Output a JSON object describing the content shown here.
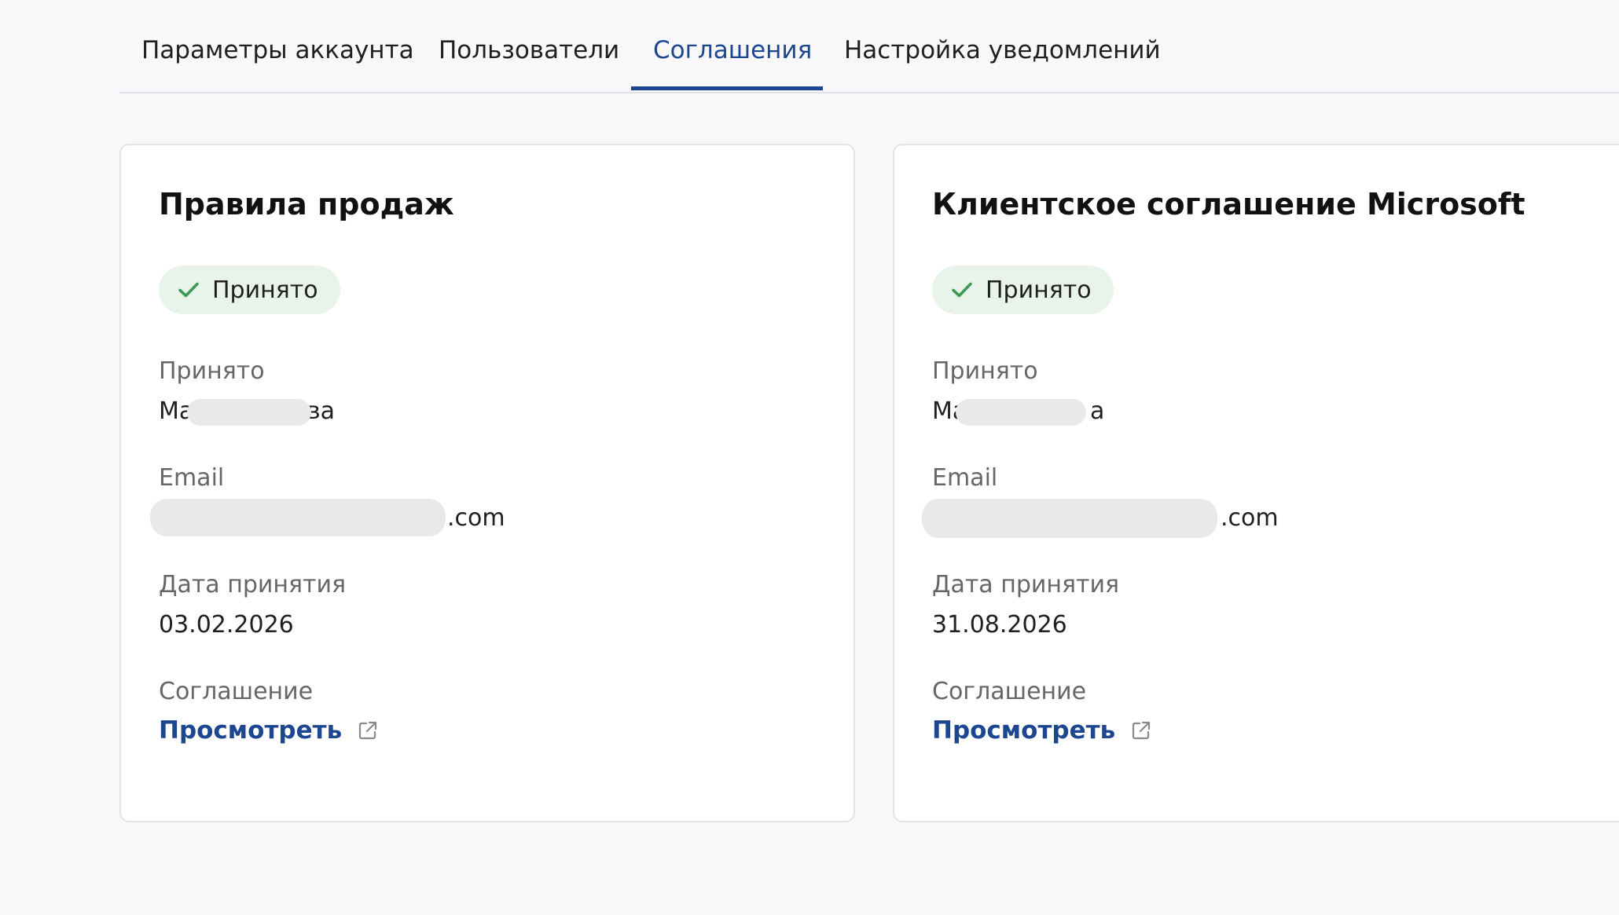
{
  "tabs": [
    {
      "label": "Параметры аккаунта",
      "active": false
    },
    {
      "label": "Пользователи",
      "active": false
    },
    {
      "label": "Соглашения",
      "active": true
    },
    {
      "label": "Настройка уведомлений",
      "active": false
    }
  ],
  "colors": {
    "accent": "#1d4690",
    "badge_bg": "#e8f3ea",
    "check": "#3a9a56"
  },
  "cards": [
    {
      "title": "Правила продаж",
      "status": "Принято",
      "status_icon": "checkmark-icon",
      "accepted_by_label": "Принято",
      "name_prefix": "Ma",
      "name_suffix": "ва",
      "email_label": "Email",
      "email_suffix": ".com",
      "date_label": "Дата принятия",
      "date": "03.02.2026",
      "agreement_label": "Соглашение",
      "view_label": "Просмотреть",
      "view_icon": "external-link-icon"
    },
    {
      "title": "Клиентское соглашение Microsoft",
      "status": "Принято",
      "status_icon": "checkmark-icon",
      "accepted_by_label": "Принято",
      "name_prefix": "Ma",
      "name_suffix": "a",
      "email_label": "Email",
      "email_suffix": ".com",
      "date_label": "Дата принятия",
      "date": "31.08.2026",
      "agreement_label": "Соглашение",
      "view_label": "Просмотреть",
      "view_icon": "external-link-icon"
    }
  ]
}
